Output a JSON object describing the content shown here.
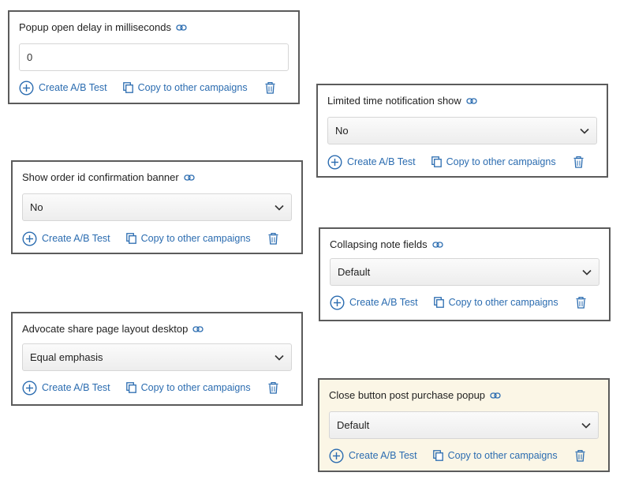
{
  "actions": {
    "ab_test": "Create A/B Test",
    "copy": "Copy to other campaigns"
  },
  "colors": {
    "accent": "#2b6cb0",
    "border": "#5b5b5b",
    "highlight_bg": "#fbf6e6"
  },
  "cards": {
    "popup_delay": {
      "title": "Popup open delay in milliseconds",
      "value": "0"
    },
    "limited_time": {
      "title": "Limited time notification show",
      "value": "No"
    },
    "order_id_banner": {
      "title": "Show order id confirmation banner",
      "value": "No"
    },
    "collapsing_notes": {
      "title": "Collapsing note fields",
      "value": "Default"
    },
    "advocate_layout": {
      "title": "Advocate share page layout desktop",
      "value": "Equal emphasis"
    },
    "close_button": {
      "title": "Close button post purchase popup",
      "value": "Default"
    }
  }
}
